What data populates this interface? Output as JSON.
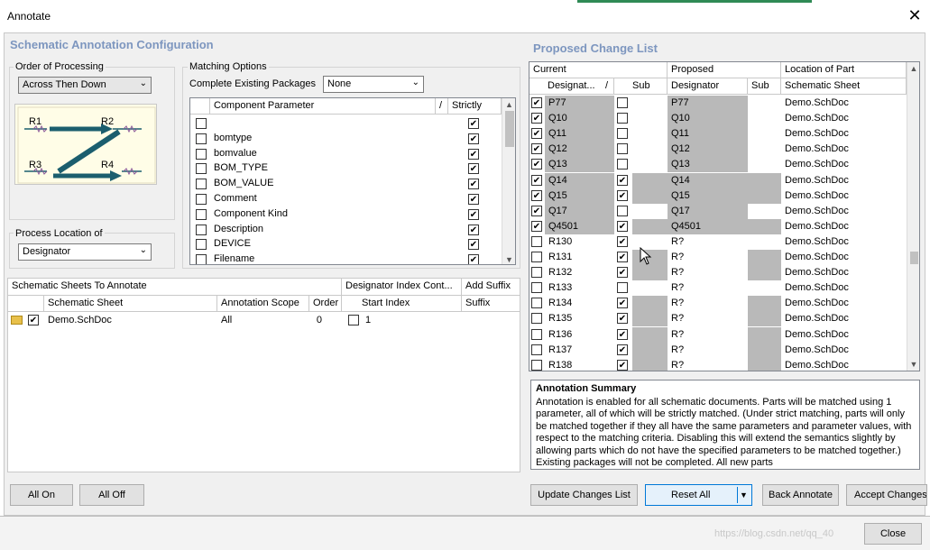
{
  "window": {
    "title": "Annotate"
  },
  "left": {
    "title": "Schematic Annotation Configuration",
    "order_label": "Order of Processing",
    "order_value": "Across Then Down",
    "diagram_labels": [
      "R1",
      "R2",
      "R3",
      "R4"
    ],
    "process_location_label": "Process Location of",
    "process_location_value": "Designator",
    "matching_label": "Matching Options",
    "complete_packages_label": "Complete Existing Packages",
    "complete_packages_value": "None",
    "params_headers": [
      "Component Parameter",
      "/",
      "Strictly"
    ],
    "params": [
      {
        "name": "",
        "checked": false,
        "strict": true
      },
      {
        "name": "bomtype",
        "checked": false,
        "strict": true
      },
      {
        "name": "bomvalue",
        "checked": false,
        "strict": true
      },
      {
        "name": "BOM_TYPE",
        "checked": false,
        "strict": true
      },
      {
        "name": "BOM_VALUE",
        "checked": false,
        "strict": true
      },
      {
        "name": "Comment",
        "checked": false,
        "strict": true
      },
      {
        "name": "Component Kind",
        "checked": false,
        "strict": true
      },
      {
        "name": "Description",
        "checked": false,
        "strict": true
      },
      {
        "name": "DEVICE",
        "checked": false,
        "strict": true
      },
      {
        "name": "Filename",
        "checked": false,
        "strict": true
      }
    ],
    "sheets_group_headers": [
      "Schematic Sheets To Annotate",
      "Designator Index Cont...",
      "Add Suffix"
    ],
    "sheets_headers": [
      "Schematic Sheet",
      "Annotation Scope",
      "Order",
      "Start Index",
      "Suffix"
    ],
    "sheets": [
      {
        "name": "Demo.SchDoc",
        "scope": "All",
        "order": "0",
        "start": "1",
        "suffix": ""
      }
    ],
    "all_on": "All On",
    "all_off": "All Off"
  },
  "right": {
    "title": "Proposed Change List",
    "group_headers": [
      "Current",
      "Proposed",
      "Location of Part"
    ],
    "headers": [
      "Designat...",
      "/",
      "Sub",
      "Designator",
      "Sub",
      "Schematic Sheet"
    ],
    "rows": [
      {
        "chk": true,
        "cur": "P77",
        "sub": false,
        "prop": "P77",
        "sheet": "Demo.SchDoc",
        "shade_cur": true,
        "shade_sub": false
      },
      {
        "chk": true,
        "cur": "Q10",
        "sub": false,
        "prop": "Q10",
        "sheet": "Demo.SchDoc",
        "shade_cur": true,
        "shade_sub": false
      },
      {
        "chk": true,
        "cur": "Q11",
        "sub": false,
        "prop": "Q11",
        "sheet": "Demo.SchDoc",
        "shade_cur": true,
        "shade_sub": false
      },
      {
        "chk": true,
        "cur": "Q12",
        "sub": false,
        "prop": "Q12",
        "sheet": "Demo.SchDoc",
        "shade_cur": true,
        "shade_sub": false
      },
      {
        "chk": true,
        "cur": "Q13",
        "sub": false,
        "prop": "Q13",
        "sheet": "Demo.SchDoc",
        "shade_cur": true,
        "shade_sub": false
      },
      {
        "chk": true,
        "cur": "Q14",
        "sub": true,
        "prop": "Q14",
        "sheet": "Demo.SchDoc",
        "shade_cur": true,
        "shade_sub": true
      },
      {
        "chk": true,
        "cur": "Q15",
        "sub": true,
        "prop": "Q15",
        "sheet": "Demo.SchDoc",
        "shade_cur": true,
        "shade_sub": true
      },
      {
        "chk": true,
        "cur": "Q17",
        "sub": false,
        "prop": "Q17",
        "sheet": "Demo.SchDoc",
        "shade_cur": true,
        "shade_sub": false
      },
      {
        "chk": true,
        "cur": "Q4501",
        "sub": true,
        "prop": "Q4501",
        "sheet": "Demo.SchDoc",
        "shade_cur": true,
        "shade_sub": true
      },
      {
        "chk": false,
        "cur": "R130",
        "sub": true,
        "prop": "R?",
        "sheet": "Demo.SchDoc",
        "shade_cur": false,
        "shade_sub": false
      },
      {
        "chk": false,
        "cur": "R131",
        "sub": true,
        "prop": "R?",
        "sheet": "Demo.SchDoc",
        "shade_cur": false,
        "shade_sub": true
      },
      {
        "chk": false,
        "cur": "R132",
        "sub": true,
        "prop": "R?",
        "sheet": "Demo.SchDoc",
        "shade_cur": false,
        "shade_sub": true
      },
      {
        "chk": false,
        "cur": "R133",
        "sub": false,
        "prop": "R?",
        "sheet": "Demo.SchDoc",
        "shade_cur": false,
        "shade_sub": false
      },
      {
        "chk": false,
        "cur": "R134",
        "sub": true,
        "prop": "R?",
        "sheet": "Demo.SchDoc",
        "shade_cur": false,
        "shade_sub": true
      },
      {
        "chk": false,
        "cur": "R135",
        "sub": true,
        "prop": "R?",
        "sheet": "Demo.SchDoc",
        "shade_cur": false,
        "shade_sub": true
      },
      {
        "chk": false,
        "cur": "R136",
        "sub": true,
        "prop": "R?",
        "sheet": "Demo.SchDoc",
        "shade_cur": false,
        "shade_sub": true
      },
      {
        "chk": false,
        "cur": "R137",
        "sub": true,
        "prop": "R?",
        "sheet": "Demo.SchDoc",
        "shade_cur": false,
        "shade_sub": true
      },
      {
        "chk": false,
        "cur": "R138",
        "sub": true,
        "prop": "R?",
        "sheet": "Demo.SchDoc",
        "shade_cur": false,
        "shade_sub": true
      }
    ],
    "summary_title": "Annotation Summary",
    "summary_text": "Annotation is enabled for all schematic documents. Parts will be matched using 1 parameter, all of which will be strictly matched. (Under strict matching, parts will only be matched together if they all have the same parameters and parameter values, with respect to the matching criteria. Disabling this will extend the semantics slightly by allowing parts which do not have the specified parameters to be matched together.) Existing packages will not be completed. All new parts",
    "buttons": {
      "update": "Update Changes List",
      "reset": "Reset All",
      "back": "Back Annotate",
      "accept": "Accept Changes"
    }
  },
  "footer": {
    "watermark": "https://blog.csdn.net/qq_40",
    "close": "Close"
  },
  "colors": {
    "section_title": "#7d96bf",
    "shade": "#b9b9b9",
    "wire": "#1b5e6e"
  }
}
